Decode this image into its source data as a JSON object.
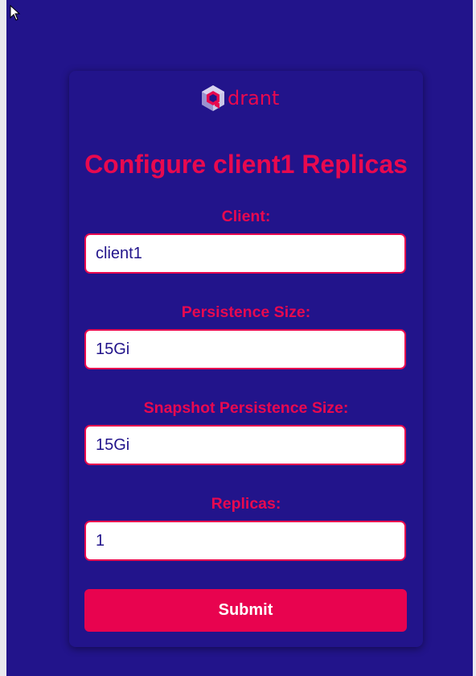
{
  "logo": {
    "text": "drant",
    "icon": "qdrant-logo-icon"
  },
  "form": {
    "title": "Configure client1 Replicas",
    "fields": [
      {
        "label": "Client:",
        "value": "client1"
      },
      {
        "label": "Persistence Size:",
        "value": "15Gi"
      },
      {
        "label": "Snapshot Persistence Size:",
        "value": "15Gi"
      },
      {
        "label": "Replicas:",
        "value": "1"
      }
    ],
    "submit_label": "Submit"
  },
  "colors": {
    "background": "#22148b",
    "accent": "#e8094f",
    "input_bg": "#ffffff"
  },
  "icons": {
    "cursor": "mouse-pointer-icon"
  }
}
